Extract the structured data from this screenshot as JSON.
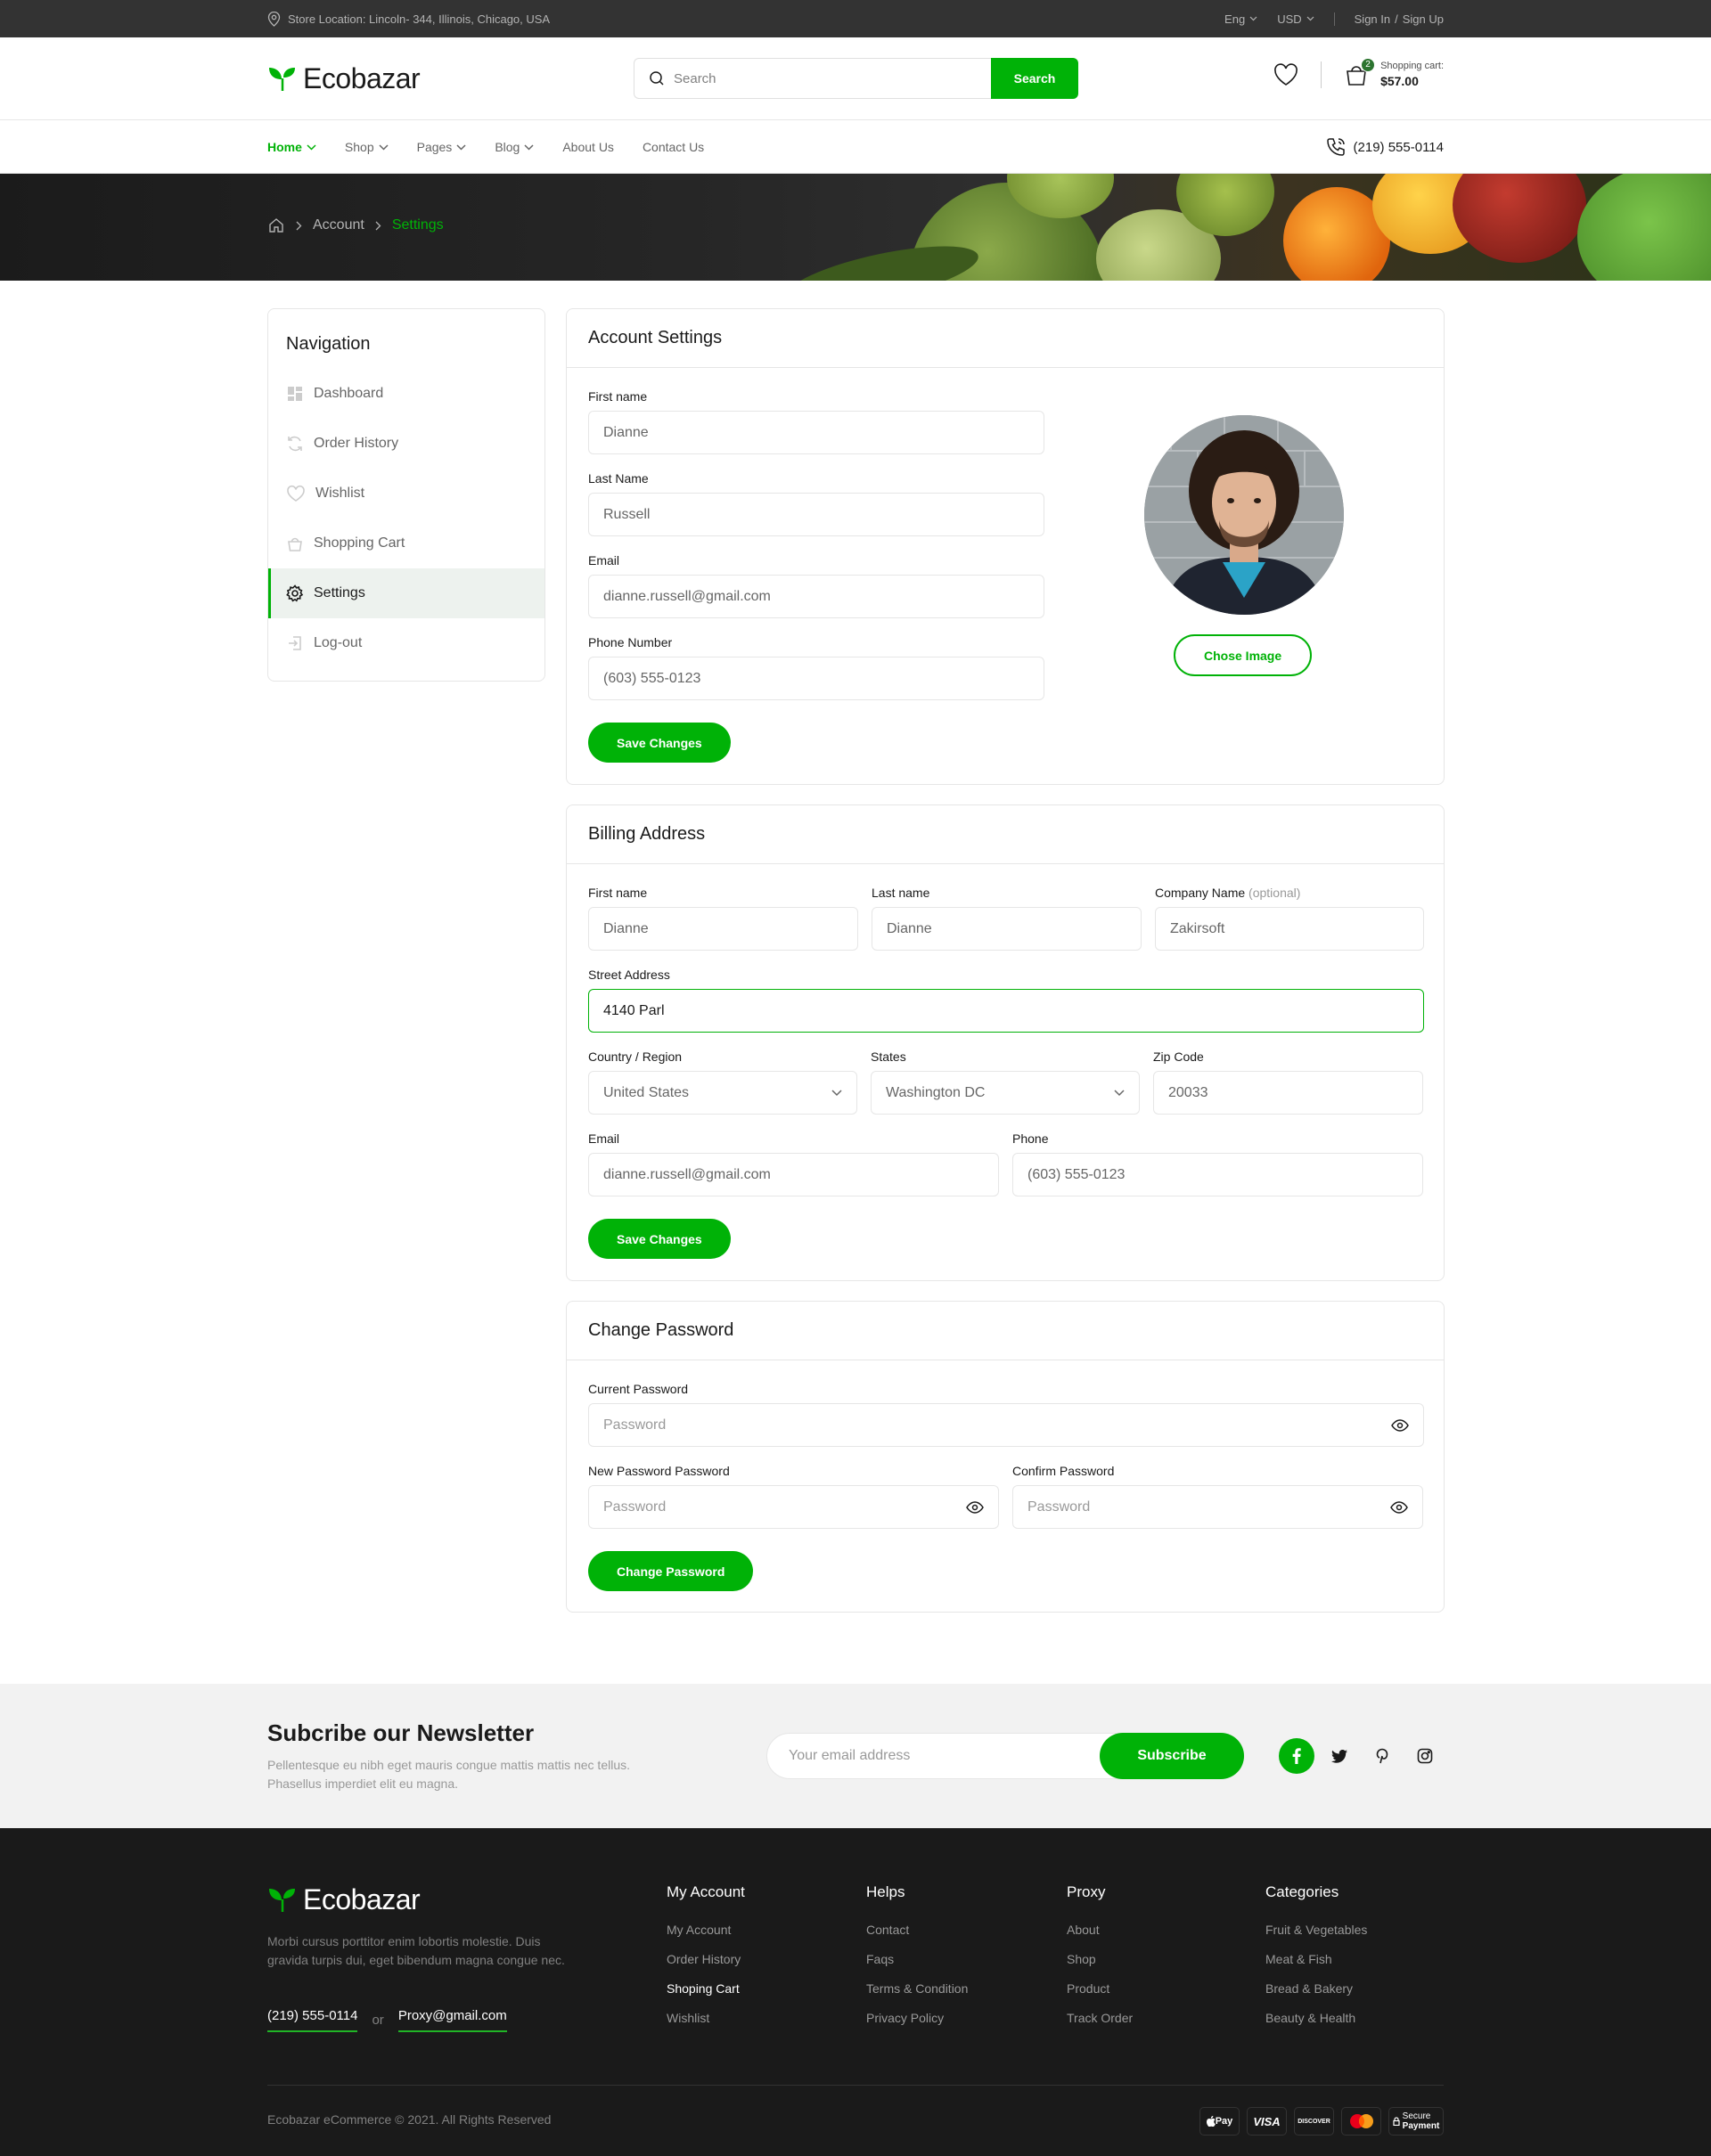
{
  "topbar": {
    "location": "Store Location: Lincoln- 344, Illinois, Chicago, USA",
    "language": "Eng",
    "currency": "USD",
    "sign_in": "Sign In",
    "separator": "/",
    "sign_up": "Sign Up"
  },
  "header": {
    "brand": "Ecobazar",
    "search_placeholder": "Search",
    "search_button": "Search",
    "cart_count": "2",
    "cart_label": "Shopping cart:",
    "cart_total": "$57.00"
  },
  "nav": {
    "items": [
      "Home",
      "Shop",
      "Pages",
      "Blog",
      "About Us",
      "Contact Us"
    ],
    "phone": "(219) 555-0114"
  },
  "breadcrumb": {
    "parent": "Account",
    "current": "Settings"
  },
  "sidebar": {
    "title": "Navigation",
    "items": [
      "Dashboard",
      "Order History",
      "Wishlist",
      "Shopping Cart",
      "Settings",
      "Log-out"
    ]
  },
  "account": {
    "title": "Account Settings",
    "first_name_label": "First name",
    "first_name": "Dianne",
    "last_name_label": "Last Name",
    "last_name": "Russell",
    "email_label": "Email",
    "email": "dianne.russell@gmail.com",
    "phone_label": "Phone Number",
    "phone": "(603) 555-0123",
    "save": "Save Changes",
    "chose_image": "Chose Image"
  },
  "billing": {
    "title": "Billing Address",
    "first_name_label": "First name",
    "first_name": "Dianne",
    "last_name_label": "Last name",
    "last_name": "Dianne",
    "company_label": "Company Name",
    "optional": "(optional)",
    "company": "Zakirsoft",
    "street_label": "Street Address",
    "street": "4140 Parl",
    "country_label": "Country / Region",
    "country": "United States",
    "state_label": "States",
    "state": "Washington DC",
    "zip_label": "Zip Code",
    "zip": "20033",
    "email_label": "Email",
    "email": "dianne.russell@gmail.com",
    "phone_label": "Phone",
    "phone": "(603) 555-0123",
    "save": "Save Changes"
  },
  "password": {
    "title": "Change Password",
    "current_label": "Current Password",
    "new_label": "New Password Password",
    "confirm_label": "Confirm Password",
    "placeholder": "Password",
    "button": "Change Password"
  },
  "newsletter": {
    "title": "Subcribe our Newsletter",
    "description": "Pellentesque eu nibh eget mauris congue mattis mattis nec tellus. Phasellus imperdiet elit eu magna.",
    "placeholder": "Your email address",
    "button": "Subscribe"
  },
  "footer": {
    "brand": "Ecobazar",
    "description": "Morbi cursus porttitor enim lobortis molestie. Duis gravida turpis dui, eget bibendum magna congue nec.",
    "phone": "(219) 555-0114",
    "or": "or",
    "email": "Proxy@gmail.com",
    "columns": [
      {
        "title": "My Account",
        "links": [
          "My Account",
          "Order History",
          "Shoping Cart",
          "Wishlist"
        ]
      },
      {
        "title": "Helps",
        "links": [
          "Contact",
          "Faqs",
          "Terms & Condition",
          "Privacy Policy"
        ]
      },
      {
        "title": "Proxy",
        "links": [
          "About",
          "Shop",
          "Product",
          "Track Order"
        ]
      },
      {
        "title": "Categories",
        "links": [
          "Fruit & Vegetables",
          "Meat & Fish",
          "Bread & Bakery",
          "Beauty & Health"
        ]
      }
    ],
    "copyright": "Ecobazar eCommerce © 2021. All Rights Reserved",
    "payments": [
      "Pay",
      "VISA",
      "DISCOVER",
      "",
      "Secure",
      "Payment"
    ]
  },
  "colors": {
    "primary": "#00b207",
    "dark": "#1a1a1a",
    "topbar": "#333333"
  }
}
